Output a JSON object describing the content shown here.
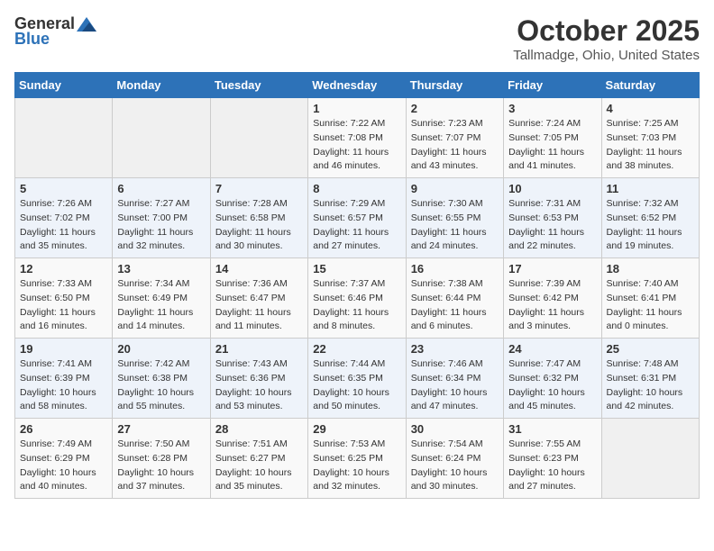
{
  "logo": {
    "general": "General",
    "blue": "Blue"
  },
  "title": "October 2025",
  "location": "Tallmadge, Ohio, United States",
  "days_of_week": [
    "Sunday",
    "Monday",
    "Tuesday",
    "Wednesday",
    "Thursday",
    "Friday",
    "Saturday"
  ],
  "weeks": [
    [
      {
        "day": "",
        "info": ""
      },
      {
        "day": "",
        "info": ""
      },
      {
        "day": "",
        "info": ""
      },
      {
        "day": "1",
        "info": "Sunrise: 7:22 AM\nSunset: 7:08 PM\nDaylight: 11 hours\nand 46 minutes."
      },
      {
        "day": "2",
        "info": "Sunrise: 7:23 AM\nSunset: 7:07 PM\nDaylight: 11 hours\nand 43 minutes."
      },
      {
        "day": "3",
        "info": "Sunrise: 7:24 AM\nSunset: 7:05 PM\nDaylight: 11 hours\nand 41 minutes."
      },
      {
        "day": "4",
        "info": "Sunrise: 7:25 AM\nSunset: 7:03 PM\nDaylight: 11 hours\nand 38 minutes."
      }
    ],
    [
      {
        "day": "5",
        "info": "Sunrise: 7:26 AM\nSunset: 7:02 PM\nDaylight: 11 hours\nand 35 minutes."
      },
      {
        "day": "6",
        "info": "Sunrise: 7:27 AM\nSunset: 7:00 PM\nDaylight: 11 hours\nand 32 minutes."
      },
      {
        "day": "7",
        "info": "Sunrise: 7:28 AM\nSunset: 6:58 PM\nDaylight: 11 hours\nand 30 minutes."
      },
      {
        "day": "8",
        "info": "Sunrise: 7:29 AM\nSunset: 6:57 PM\nDaylight: 11 hours\nand 27 minutes."
      },
      {
        "day": "9",
        "info": "Sunrise: 7:30 AM\nSunset: 6:55 PM\nDaylight: 11 hours\nand 24 minutes."
      },
      {
        "day": "10",
        "info": "Sunrise: 7:31 AM\nSunset: 6:53 PM\nDaylight: 11 hours\nand 22 minutes."
      },
      {
        "day": "11",
        "info": "Sunrise: 7:32 AM\nSunset: 6:52 PM\nDaylight: 11 hours\nand 19 minutes."
      }
    ],
    [
      {
        "day": "12",
        "info": "Sunrise: 7:33 AM\nSunset: 6:50 PM\nDaylight: 11 hours\nand 16 minutes."
      },
      {
        "day": "13",
        "info": "Sunrise: 7:34 AM\nSunset: 6:49 PM\nDaylight: 11 hours\nand 14 minutes."
      },
      {
        "day": "14",
        "info": "Sunrise: 7:36 AM\nSunset: 6:47 PM\nDaylight: 11 hours\nand 11 minutes."
      },
      {
        "day": "15",
        "info": "Sunrise: 7:37 AM\nSunset: 6:46 PM\nDaylight: 11 hours\nand 8 minutes."
      },
      {
        "day": "16",
        "info": "Sunrise: 7:38 AM\nSunset: 6:44 PM\nDaylight: 11 hours\nand 6 minutes."
      },
      {
        "day": "17",
        "info": "Sunrise: 7:39 AM\nSunset: 6:42 PM\nDaylight: 11 hours\nand 3 minutes."
      },
      {
        "day": "18",
        "info": "Sunrise: 7:40 AM\nSunset: 6:41 PM\nDaylight: 11 hours\nand 0 minutes."
      }
    ],
    [
      {
        "day": "19",
        "info": "Sunrise: 7:41 AM\nSunset: 6:39 PM\nDaylight: 10 hours\nand 58 minutes."
      },
      {
        "day": "20",
        "info": "Sunrise: 7:42 AM\nSunset: 6:38 PM\nDaylight: 10 hours\nand 55 minutes."
      },
      {
        "day": "21",
        "info": "Sunrise: 7:43 AM\nSunset: 6:36 PM\nDaylight: 10 hours\nand 53 minutes."
      },
      {
        "day": "22",
        "info": "Sunrise: 7:44 AM\nSunset: 6:35 PM\nDaylight: 10 hours\nand 50 minutes."
      },
      {
        "day": "23",
        "info": "Sunrise: 7:46 AM\nSunset: 6:34 PM\nDaylight: 10 hours\nand 47 minutes."
      },
      {
        "day": "24",
        "info": "Sunrise: 7:47 AM\nSunset: 6:32 PM\nDaylight: 10 hours\nand 45 minutes."
      },
      {
        "day": "25",
        "info": "Sunrise: 7:48 AM\nSunset: 6:31 PM\nDaylight: 10 hours\nand 42 minutes."
      }
    ],
    [
      {
        "day": "26",
        "info": "Sunrise: 7:49 AM\nSunset: 6:29 PM\nDaylight: 10 hours\nand 40 minutes."
      },
      {
        "day": "27",
        "info": "Sunrise: 7:50 AM\nSunset: 6:28 PM\nDaylight: 10 hours\nand 37 minutes."
      },
      {
        "day": "28",
        "info": "Sunrise: 7:51 AM\nSunset: 6:27 PM\nDaylight: 10 hours\nand 35 minutes."
      },
      {
        "day": "29",
        "info": "Sunrise: 7:53 AM\nSunset: 6:25 PM\nDaylight: 10 hours\nand 32 minutes."
      },
      {
        "day": "30",
        "info": "Sunrise: 7:54 AM\nSunset: 6:24 PM\nDaylight: 10 hours\nand 30 minutes."
      },
      {
        "day": "31",
        "info": "Sunrise: 7:55 AM\nSunset: 6:23 PM\nDaylight: 10 hours\nand 27 minutes."
      },
      {
        "day": "",
        "info": ""
      }
    ]
  ]
}
